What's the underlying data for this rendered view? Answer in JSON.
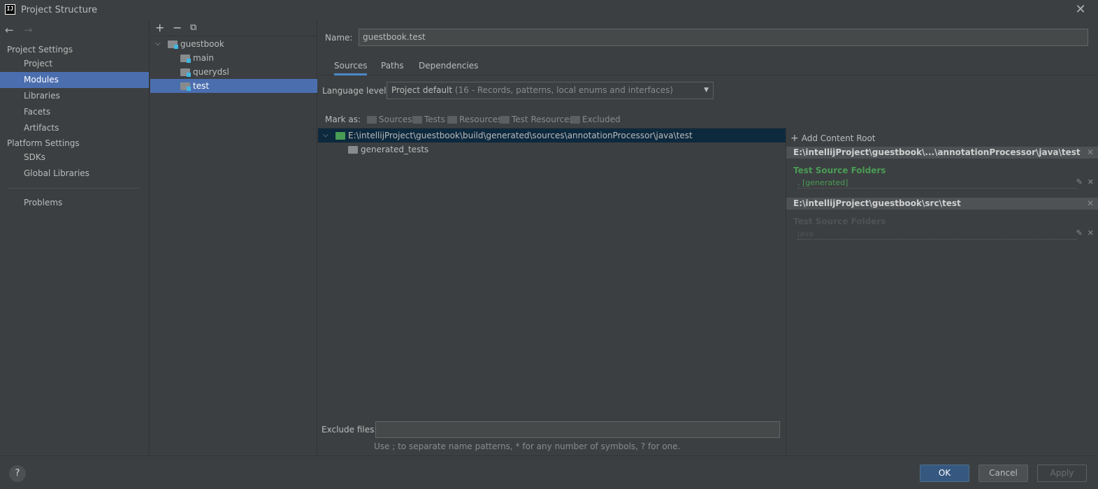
{
  "window": {
    "title": "Project Structure",
    "logo_text": "IJ"
  },
  "nav": {
    "back_icon": "←",
    "forward_icon": "→",
    "sections": [
      {
        "label": "Project Settings",
        "items": [
          "Project",
          "Modules",
          "Libraries",
          "Facets",
          "Artifacts"
        ]
      },
      {
        "label": "Platform Settings",
        "items": [
          "SDKs",
          "Global Libraries"
        ]
      }
    ],
    "problems": "Problems",
    "selected": "Modules"
  },
  "tree": {
    "toolbar": {
      "add": "+",
      "remove": "−",
      "copy": "⧉"
    },
    "root": "guestbook",
    "children": [
      "main",
      "querydsl",
      "test"
    ],
    "selected": "test"
  },
  "module": {
    "name_label": "Name:",
    "name_value": "guestbook.test",
    "tabs": [
      "Sources",
      "Paths",
      "Dependencies"
    ],
    "active_tab": "Sources",
    "language_label": "Language level:",
    "language_value": "Project default",
    "language_detail": "(16 - Records, patterns, local enums and interfaces)",
    "mark_as_label": "Mark as:",
    "mark_as": [
      "Sources",
      "Tests",
      "Resources",
      "Test Resources",
      "Excluded"
    ]
  },
  "source_tree": {
    "root_path": "E:\\intellijProject\\guestbook\\build\\generated\\sources\\annotationProcessor\\java\\test",
    "child": "generated_tests"
  },
  "content_roots": {
    "add_label": "Add Content Root",
    "roots": [
      {
        "path": "E:\\intellijProject\\guestbook\\...\\annotationProcessor\\java\\test",
        "group": "Test Source Folders",
        "entry": ". [generated]",
        "color": "#499c54"
      },
      {
        "path": "E:\\intellijProject\\guestbook\\src\\test",
        "group": "Test Source Folders",
        "entry": "java",
        "color": "#4e5254"
      }
    ]
  },
  "exclude": {
    "label": "Exclude files:",
    "value": "",
    "hint": "Use ; to separate name patterns, * for any number of symbols, ? for one."
  },
  "buttons": {
    "help": "?",
    "ok": "OK",
    "cancel": "Cancel",
    "apply": "Apply"
  }
}
